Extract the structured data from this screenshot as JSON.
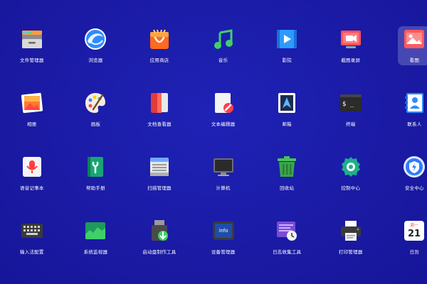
{
  "launcher": {
    "apps": [
      {
        "label": "文件管理器",
        "icon": "file-manager-icon"
      },
      {
        "label": "浏览器",
        "icon": "browser-icon"
      },
      {
        "label": "应用商店",
        "icon": "app-store-icon"
      },
      {
        "label": "音乐",
        "icon": "music-icon"
      },
      {
        "label": "影院",
        "icon": "video-icon"
      },
      {
        "label": "截图录屏",
        "icon": "screen-recorder-icon"
      },
      {
        "label": "看图",
        "icon": "image-viewer-icon",
        "selected": true
      },
      {
        "label": "相册",
        "icon": "album-icon"
      },
      {
        "label": "画板",
        "icon": "palette-icon"
      },
      {
        "label": "文档查看器",
        "icon": "document-viewer-icon"
      },
      {
        "label": "文本编辑器",
        "icon": "text-editor-icon"
      },
      {
        "label": "邮箱",
        "icon": "mail-icon"
      },
      {
        "label": "终端",
        "icon": "terminal-icon"
      },
      {
        "label": "联系人",
        "icon": "contacts-icon"
      },
      {
        "label": "语音记事本",
        "icon": "voice-notes-icon"
      },
      {
        "label": "帮助手册",
        "icon": "help-manual-icon"
      },
      {
        "label": "扫描管理器",
        "icon": "scanner-icon"
      },
      {
        "label": "计算机",
        "icon": "computer-icon"
      },
      {
        "label": "回收站",
        "icon": "trash-icon"
      },
      {
        "label": "控制中心",
        "icon": "control-center-icon"
      },
      {
        "label": "安全中心",
        "icon": "security-center-icon"
      },
      {
        "label": "输入法配置",
        "icon": "keyboard-icon"
      },
      {
        "label": "系统监视器",
        "icon": "system-monitor-icon"
      },
      {
        "label": "启动盘制作工具",
        "icon": "boot-maker-icon"
      },
      {
        "label": "设备管理器",
        "icon": "device-manager-icon"
      },
      {
        "label": "日志收集工具",
        "icon": "log-collector-icon"
      },
      {
        "label": "打印管理器",
        "icon": "print-manager-icon"
      },
      {
        "label": "日历",
        "icon": "calendar-icon"
      }
    ],
    "icon_text": {
      "terminal_prompt": "$ _",
      "device_badge": "info",
      "calendar_weekday": "周一",
      "calendar_day": "21"
    }
  }
}
